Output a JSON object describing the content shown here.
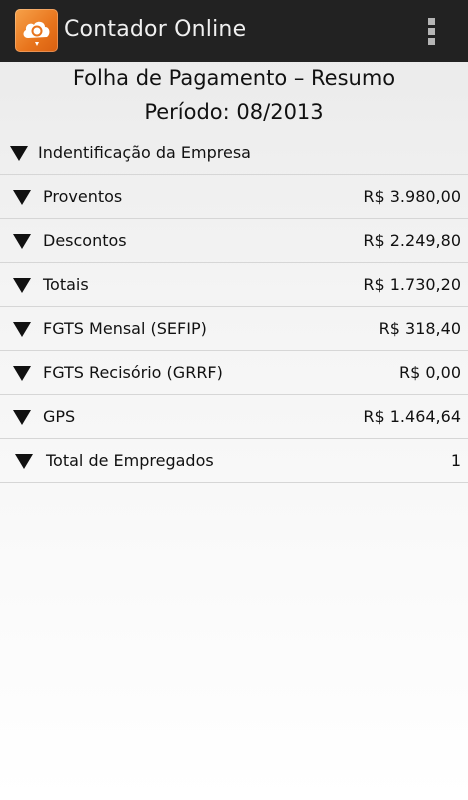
{
  "app": {
    "title": "Contador Online",
    "icon": "cloud-coin-icon",
    "overflow_icon": "more-vertical-icon",
    "accent_color": "#e8741c",
    "bar_color": "#222222"
  },
  "report": {
    "title": "Folha de Pagamento – Resumo",
    "period": "Período: 08/2013"
  },
  "sections": [
    {
      "label": "Indentificação da Empresa",
      "value": ""
    },
    {
      "label": "Proventos",
      "value": "R$ 3.980,00"
    },
    {
      "label": "Descontos",
      "value": "R$ 2.249,80"
    },
    {
      "label": "Totais",
      "value": "R$ 1.730,20"
    },
    {
      "label": "FGTS Mensal (SEFIP)",
      "value": "R$ 318,40"
    },
    {
      "label": "FGTS Recisório (GRRF)",
      "value": "R$ 0,00"
    },
    {
      "label": "GPS",
      "value": "R$ 1.464,64"
    },
    {
      "label": "Total de Empregados",
      "value": "1"
    }
  ]
}
